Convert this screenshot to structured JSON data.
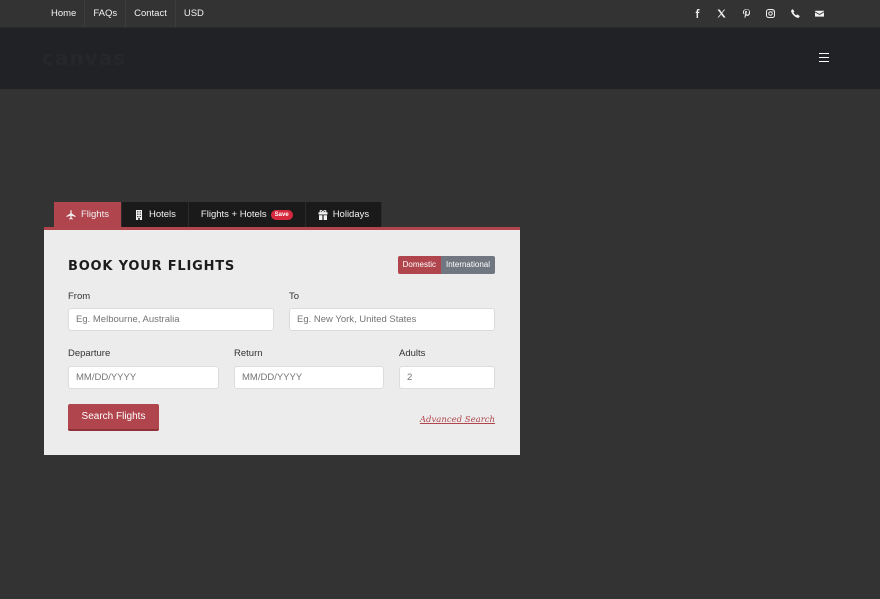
{
  "topnav": {
    "items": [
      "Home",
      "FAQs",
      "Contact",
      "USD"
    ]
  },
  "social": [
    "facebook-icon",
    "x-icon",
    "pinterest-icon",
    "instagram-icon",
    "phone-icon",
    "email-icon"
  ],
  "header": {
    "logo": "canvas"
  },
  "tabs": [
    {
      "label": "Flights",
      "icon": "plane-icon",
      "active": true
    },
    {
      "label": "Hotels",
      "icon": "building-icon",
      "active": false
    },
    {
      "label": "Flights + Hotels",
      "badge": "Save",
      "active": false
    },
    {
      "label": "Holidays",
      "icon": "gift-icon",
      "active": false
    }
  ],
  "booking": {
    "title": "BOOK YOUR FLIGHTS",
    "toggle": {
      "domestic": "Domestic",
      "international": "International",
      "selected": "Domestic"
    },
    "from_label": "From",
    "from_placeholder": "Eg. Melbourne, Australia",
    "to_label": "To",
    "to_placeholder": "Eg. New York, United States",
    "departure_label": "Departure",
    "departure_placeholder": "MM/DD/YYYY",
    "return_label": "Return",
    "return_placeholder": "MM/DD/YYYY",
    "adults_label": "Adults",
    "adults_value": "2",
    "search_button": "Search Flights",
    "advanced_link": "Advanced Search"
  },
  "colors": {
    "accent": "#b0454d",
    "background": "#333333",
    "header": "#202226",
    "panel": "#ececec"
  }
}
